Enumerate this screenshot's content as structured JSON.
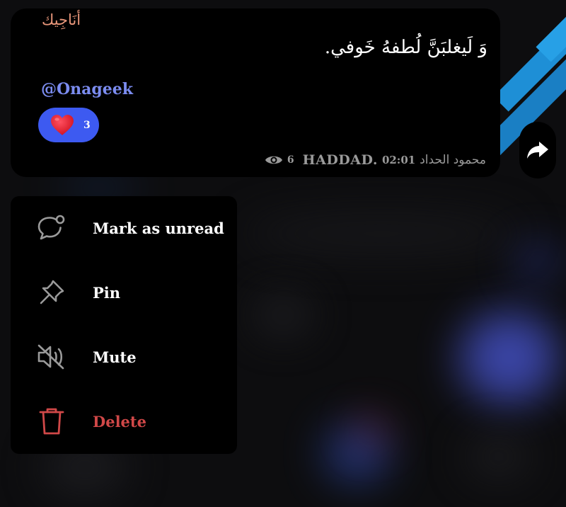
{
  "message": {
    "author": "أنَاجِيك",
    "text": "وَ لَيغلبَنَّ لُطفهُ خَوفي.",
    "handle": "@Onageek",
    "reaction": {
      "emoji": "heart",
      "count": "3"
    },
    "views": "6",
    "signature": "HADDAD.",
    "time": "02:01",
    "author_name": "محمود الحداد"
  },
  "menu": {
    "items": [
      {
        "label": "Mark as unread",
        "icon": "chat-unread-icon"
      },
      {
        "label": "Pin",
        "icon": "pin-icon"
      },
      {
        "label": "Mute",
        "icon": "mute-icon"
      },
      {
        "label": "Delete",
        "icon": "trash-icon"
      }
    ]
  },
  "colors": {
    "accent": "#3d5af1",
    "handle": "#7b8cf0",
    "author": "#e8967a",
    "danger": "#d04848"
  }
}
